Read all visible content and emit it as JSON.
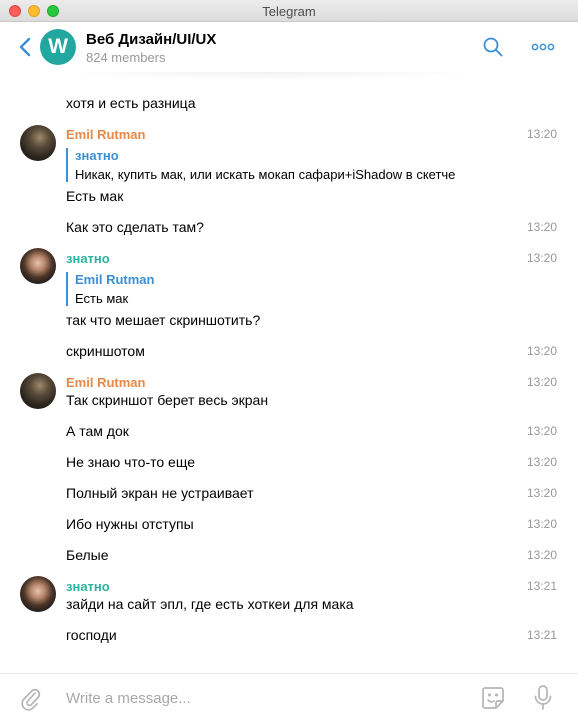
{
  "window": {
    "title": "Telegram"
  },
  "chat": {
    "avatar_letter": "W",
    "name": "Веб Дизайн/UI/UX",
    "members": "824 members",
    "accent_color": "#22a6a0"
  },
  "icons": {
    "back": "chevron-left-icon",
    "search": "search-icon",
    "more": "more-dots-icon",
    "attach": "paperclip-icon",
    "sticker": "sticker-icon",
    "mic": "microphone-icon"
  },
  "messages": [
    {
      "text": "хотя и есть разница"
    },
    {
      "sender": "Emil Rutman",
      "time": "13:20",
      "quote": {
        "author": "знатно",
        "text": "Никак, купить мак, или искать мокап сафари+iShadow в скетче"
      },
      "text": "Есть мак"
    },
    {
      "text": "Как это сделать там?",
      "time": "13:20"
    },
    {
      "sender": "знатно",
      "time": "13:20",
      "quote": {
        "author": "Emil Rutman",
        "text": "Есть мак"
      },
      "text": "так что мешает скриншотить?"
    },
    {
      "text": "скриншотом",
      "time": "13:20"
    },
    {
      "sender": "Emil Rutman",
      "time": "13:20",
      "text": "Так скриншот берет весь экран"
    },
    {
      "text": "А там док",
      "time": "13:20"
    },
    {
      "text": "Не знаю что-то еще",
      "time": "13:20"
    },
    {
      "text": "Полный экран не устраивает",
      "time": "13:20"
    },
    {
      "text": "Ибо нужны отступы",
      "time": "13:20"
    },
    {
      "text": "Белые",
      "time": "13:20"
    },
    {
      "sender": "знатно",
      "time": "13:21",
      "text": "зайди на сайт эпл, где есть хоткеи для мака"
    },
    {
      "text": "господи",
      "time": "13:21"
    }
  ],
  "composer": {
    "placeholder": "Write a message..."
  },
  "colors": {
    "sender_emil": "#e48a46",
    "sender_znatno": "#2bb3a2",
    "link_blue": "#3a8fd6",
    "timestamp": "#999999"
  }
}
